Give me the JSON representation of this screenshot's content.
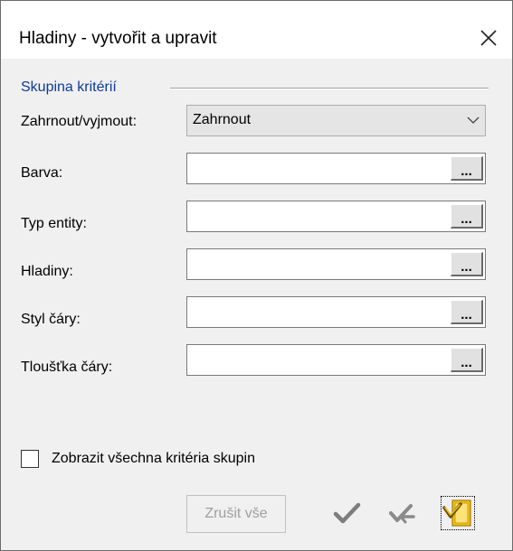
{
  "window": {
    "title": "Hladiny - vytvořit a upravit"
  },
  "group": {
    "title": "Skupina kritérií"
  },
  "include_exclude": {
    "label": "Zahrnout/vyjmout:",
    "selected": "Zahrnout"
  },
  "fields": [
    {
      "label": "Barva:",
      "value": "",
      "browse": "..."
    },
    {
      "label": "Typ entity:",
      "value": "",
      "browse": "..."
    },
    {
      "label": "Hladiny:",
      "value": "",
      "browse": "..."
    },
    {
      "label": "Styl čáry:",
      "value": "",
      "browse": "..."
    },
    {
      "label": "Tloušťka čáry:",
      "value": "",
      "browse": "..."
    }
  ],
  "show_all": {
    "label": "Zobrazit všechna kritéria skupin",
    "checked": false
  },
  "buttons": {
    "cancel_all": "Zrušit vše",
    "ok_icon": "checkmark-icon",
    "back_icon": "undo-check-icon",
    "apply_icon": "apply-yellow-icon"
  },
  "colors": {
    "group_title": "#0f3a9a",
    "apply_icon_yellow": "#f3c11b"
  }
}
